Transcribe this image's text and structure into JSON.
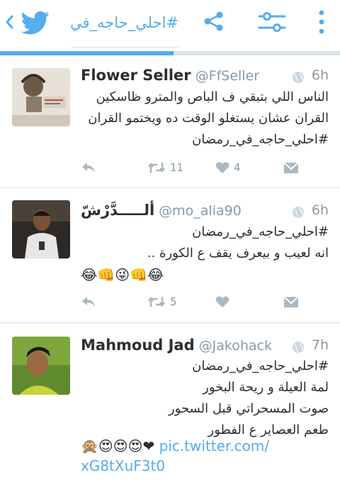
{
  "header": {
    "title": "#احلي_حاجه_في_",
    "progress_fraction": 0.51,
    "accent": "#55acee"
  },
  "tweets": [
    {
      "name": "Flower Seller",
      "handle": "@FfSeller",
      "time": "6h",
      "lines": [
        "الناس اللي بتبقي ف الباص والمترو ظاسكين",
        "القران عشان يستغلو الوقت ده ويختمو القران",
        "#احلي_حاجه_في_رمضان"
      ],
      "retweets": "11",
      "likes": "4"
    },
    {
      "name": "ألـــــدَّرْشّ",
      "handle": "@mo_alia90",
      "time": "6h",
      "lines": [
        "#احلي_حاجه_في_رمضان",
        "انه لعيب و بيعرف يقف ع الكورة .."
      ],
      "emojis": "😂👊😜👊😂",
      "retweets": "5",
      "likes": ""
    },
    {
      "name": "Mahmoud Jad",
      "handle": "@Jakohack",
      "time": "7h",
      "lines": [
        "#احلي_حاجه_في_رمضان",
        "لمة العيلة و ريحة البخور",
        "صوت المسحراتي قبل السحور",
        "طعم العصاير ع الفطور"
      ],
      "emojis": "🙊😍😍😍❤",
      "link_1": "pic.twitter.com/",
      "link_2": "xG8tXuF3t0"
    }
  ]
}
